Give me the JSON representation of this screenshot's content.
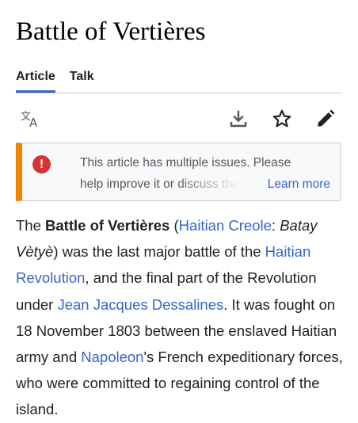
{
  "page": {
    "title": "Battle of Vertières"
  },
  "tabs": [
    {
      "label": "Article",
      "selected": true
    },
    {
      "label": "Talk",
      "selected": false
    }
  ],
  "toolbar": {
    "icons": [
      "language-icon",
      "download-icon",
      "star-icon",
      "edit-pencil-icon"
    ]
  },
  "notice": {
    "icon": "exclamation-icon",
    "line1": "This article has multiple issues. Please",
    "line2": "help improve it or discuss the",
    "learn_more": "Learn more",
    "accent_color": "#f28500",
    "icon_color": "#d73333"
  },
  "article": {
    "link_color": "#3366cc",
    "p1": "The ",
    "bold_title": "Battle of Vertières",
    "p2": " (",
    "link_haitian_creole": "Haitian Creole",
    "p3": ": ",
    "italic_name": "Batay Vètyè",
    "p4": ") was the last major battle of the ",
    "link_haitian_revolution": "Haitian Revolution",
    "p5": ", and the final part of the Revolution under ",
    "link_dessalines": "Jean Jacques Dessalines",
    "p6": ". It was fought on 18 November 1803 between the enslaved Haitian army and ",
    "link_napoleon": "Napoleon",
    "p7": "'s French expeditionary forces, who were committed to regaining control of the island."
  }
}
